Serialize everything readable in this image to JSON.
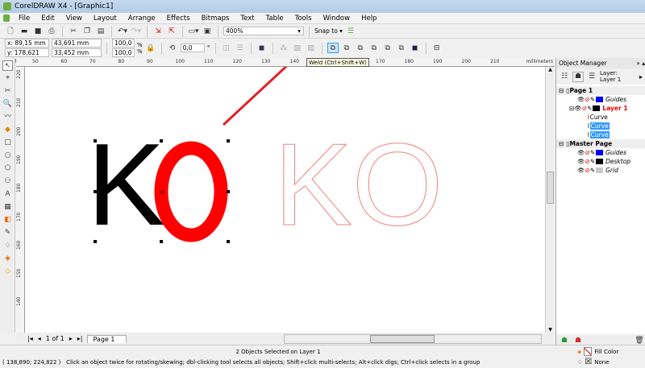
{
  "title": "CorelDRAW X4 - [Graphic1]",
  "menu": [
    "File",
    "Edit",
    "View",
    "Layout",
    "Arrange",
    "Effects",
    "Bitmaps",
    "Text",
    "Table",
    "Tools",
    "Window",
    "Help"
  ],
  "toolbar": {
    "zoom": "400%",
    "snap": "Snap to"
  },
  "propbar": {
    "x": "x: 89,15 mm",
    "y": "y: 178,621 mm",
    "w": "43,691 mm",
    "h": "33,452 mm",
    "sx": "100,0",
    "sy": "100,0",
    "pct": "%",
    "angle": "0,0",
    "deg": "°"
  },
  "tooltip": "Weld (Ctrl+Shift+W)",
  "ruler": {
    "top": [
      "50",
      "60",
      "70",
      "80",
      "90",
      "100",
      "110",
      "120",
      "130",
      "140",
      "150",
      "160",
      "170",
      "180",
      "190",
      "200",
      "210"
    ],
    "left": [
      "220",
      "210",
      "200",
      "190",
      "180",
      "170",
      "160",
      "150",
      "140"
    ],
    "unit": "millimeters"
  },
  "canvas": {
    "letter_k": "K",
    "letter_o": "O",
    "outline_text": "KO",
    "colors": {
      "red": "#ff0000",
      "outline": "#f08080"
    }
  },
  "object_manager": {
    "title": "Object Manager",
    "layer_label": "Layer:",
    "layer_value": "Layer 1",
    "rows": [
      {
        "label": "Page 1",
        "kind": "page"
      },
      {
        "label": "Guides",
        "kind": "layer",
        "color": "#0000ff"
      },
      {
        "label": "Layer 1",
        "kind": "active",
        "color": "#000000"
      },
      {
        "label": "Curve",
        "kind": "obj"
      },
      {
        "label": "Curve",
        "kind": "sel"
      },
      {
        "label": "Curve",
        "kind": "sel"
      },
      {
        "label": "Master Page",
        "kind": "page"
      },
      {
        "label": "Guides",
        "kind": "layer",
        "color": "#0000ff"
      },
      {
        "label": "Desktop",
        "kind": "layer",
        "color": "#000000"
      },
      {
        "label": "Grid",
        "kind": "layer",
        "color": "#c8c8c8"
      }
    ]
  },
  "pagebar": {
    "count": "1 of 1",
    "tab": "Page 1"
  },
  "status": {
    "selection": "2 Objects Selected on Layer 1",
    "coords": "( 138,890; 224,822 )",
    "hint": "Click an object twice for rotating/skewing; dbl-clicking tool selects all objects; Shift+click multi-selects; Alt+click digs; Ctrl+click selects in a group",
    "fill": "Fill Color",
    "outline": "None"
  }
}
